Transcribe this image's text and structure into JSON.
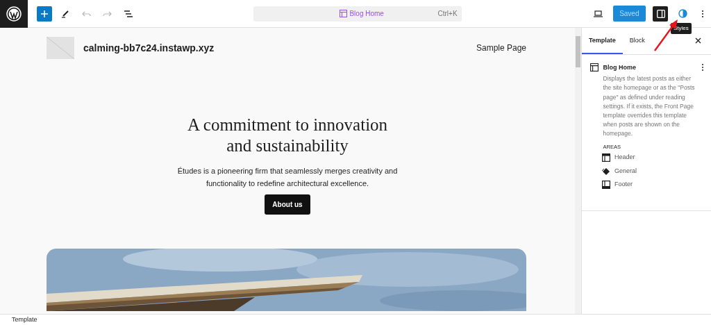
{
  "toolbar": {
    "history": [
      {
        "kind": "undo",
        "disabled": true
      },
      {
        "kind": "redo",
        "disabled": true
      }
    ]
  },
  "command_bar": {
    "title": "Blog Home",
    "shortcut": "Ctrl+K"
  },
  "actions": {
    "save_label": "Saved",
    "sidebar_open": true,
    "tooltip": "Styles"
  },
  "canvas": {
    "site_title": "calming-bb7c24.instawp.xyz",
    "nav": [
      "Sample Page"
    ],
    "heading": "A commitment to innovation and sustainability",
    "text": "Études is a pioneering firm that seamlessly merges creativity and functionality to redefine architectural excellence.",
    "button": "About us",
    "picture": {
      "kind": "picture"
    }
  },
  "sidebar": {
    "tabs": [
      {
        "label": "Template",
        "selected": true
      },
      {
        "label": "Block",
        "selected": false
      }
    ],
    "template": {
      "title": "Blog Home",
      "description": "Displays the latest posts as either the site homepage or as the \"Posts page\" as defined under reading settings. If it exists, the Front Page template overrides this template when posts are shown on the homepage."
    },
    "areas_label": "AREAS",
    "areas": [
      {
        "kind": "header",
        "label": "Header"
      },
      {
        "kind": "general",
        "label": "General"
      },
      {
        "kind": "footer",
        "label": "Footer"
      }
    ]
  },
  "status_bar": {
    "breadcrumb": "Template"
  }
}
